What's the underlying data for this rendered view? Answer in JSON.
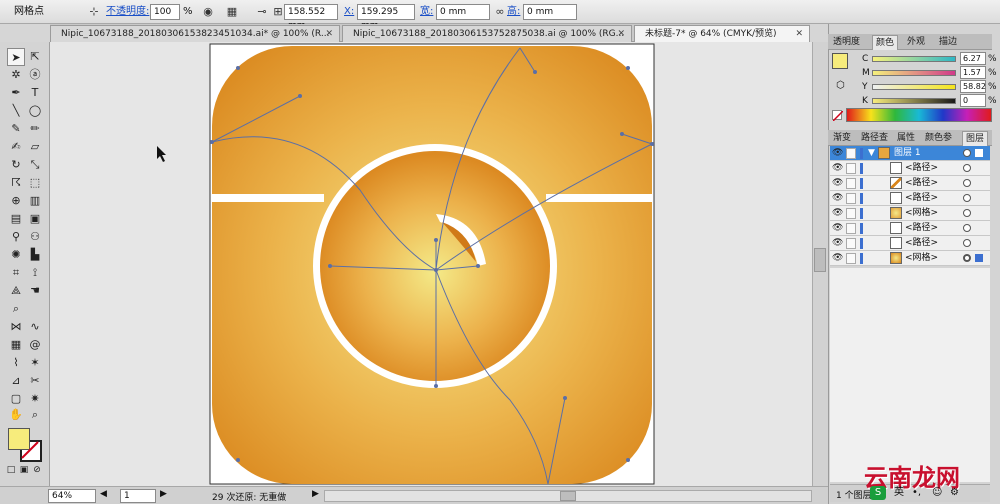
{
  "control_bar": {
    "mode_label": "网格点",
    "opacity_label": "不透明度:",
    "opacity_value": "100",
    "opacity_unit": "%",
    "x_label": "X:",
    "x_value": "158.552 mm",
    "y_label": "Y:",
    "y_value": "159.295 mm",
    "w_label": "宽:",
    "w_value": "0 mm",
    "h_label": "高:",
    "h_value": "0 mm"
  },
  "tabs": [
    {
      "label": "Nipic_10673188_20180306153823451034.ai* @ 100% (R..."
    },
    {
      "label": "Nipic_10673188_20180306153752875038.ai @ 100% (RG..."
    },
    {
      "label": "未标题-7* @ 64% (CMYK/预览)"
    }
  ],
  "status_bar": {
    "zoom": "64%",
    "artboard": "1",
    "undo_text": "29 次还原: 无重做",
    "layer_count": "1 个图层"
  },
  "color_panel": {
    "tabs": [
      "透明度",
      "颜色",
      "外观",
      "描边"
    ],
    "rows": [
      {
        "letter": "C",
        "value": "6.27"
      },
      {
        "letter": "M",
        "value": "1.57"
      },
      {
        "letter": "Y",
        "value": "58.82"
      },
      {
        "letter": "K",
        "value": "0"
      }
    ],
    "unit": "%",
    "fill_color": "#f7ec7c"
  },
  "layers_panel": {
    "tabs": [
      "渐变",
      "路径查",
      "属性",
      "颜色参",
      "图层"
    ],
    "parent": "图层 1",
    "items": [
      {
        "name": "<路径>"
      },
      {
        "name": "<路径>"
      },
      {
        "name": "<路径>"
      },
      {
        "name": "<网格>"
      },
      {
        "name": "<路径>"
      },
      {
        "name": "<路径>"
      },
      {
        "name": "<网格>"
      }
    ]
  },
  "watermark": {
    "text": "云南龙网",
    "ime_text": "英"
  },
  "colors": {
    "accent": "#3c86d8",
    "art_dark": "#d9861c",
    "art_light": "#f4e98a"
  }
}
